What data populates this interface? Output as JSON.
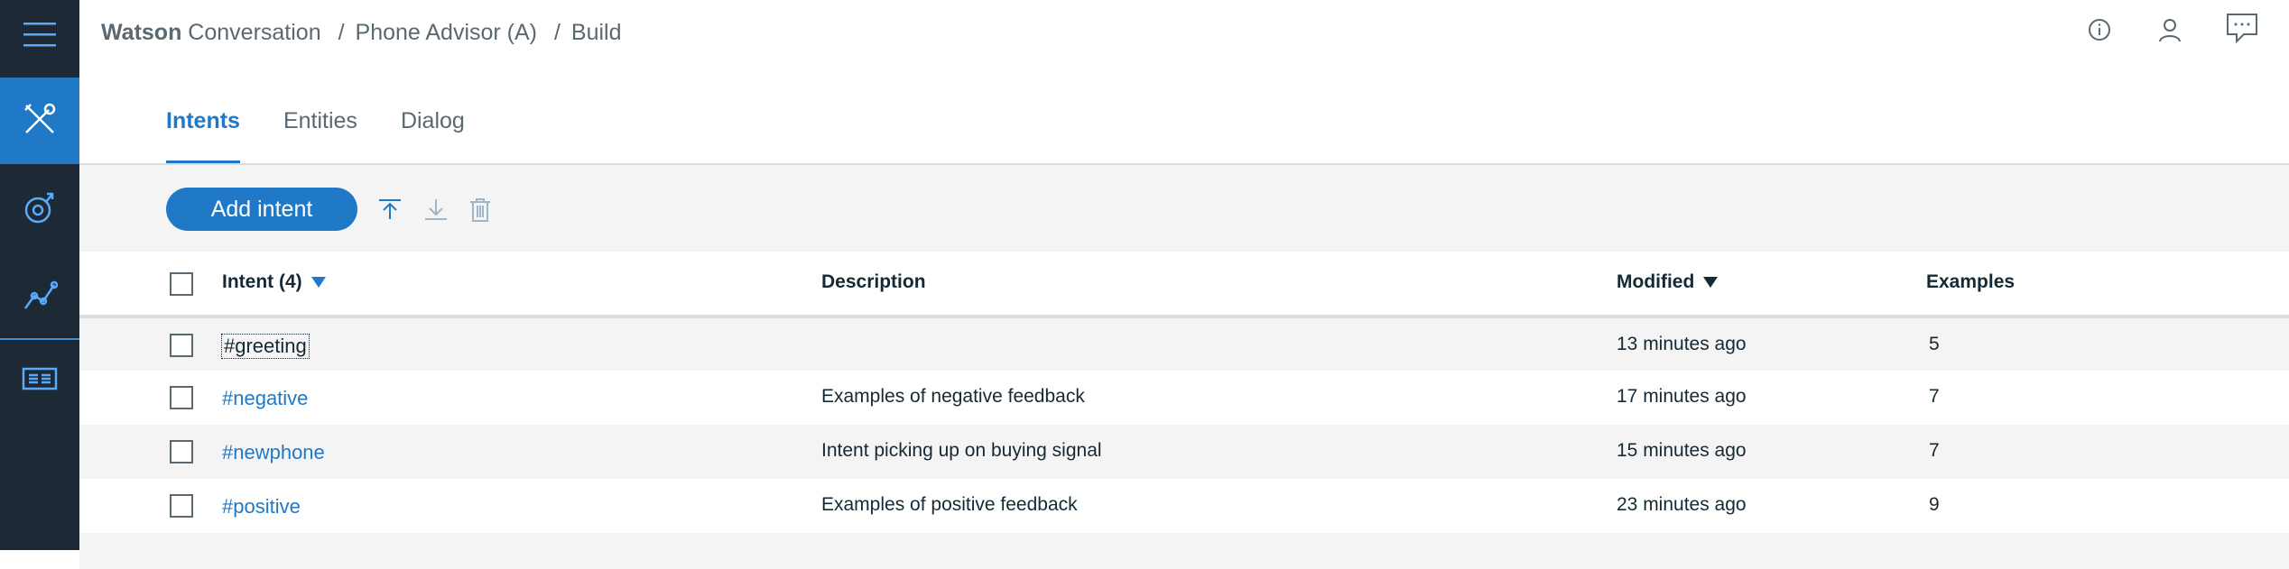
{
  "header": {
    "brand": "Watson",
    "app": "Conversation",
    "separator": "/",
    "workspace": "Phone Advisor (A)",
    "page": "Build"
  },
  "icons": {
    "header": [
      "info-icon",
      "user-icon",
      "chat-icon"
    ],
    "rail": [
      "menu-icon",
      "build-icon",
      "improve-icon",
      "analytics-icon",
      "deploy-icon"
    ],
    "toolbar": [
      "upload-icon",
      "download-icon",
      "trash-icon"
    ]
  },
  "colors": {
    "accent": "#2079c7",
    "rail_background": "#1d2a36",
    "toolbar_background": "#f4f4f4"
  },
  "tabs": [
    {
      "label": "Intents",
      "active": true
    },
    {
      "label": "Entities",
      "active": false
    },
    {
      "label": "Dialog",
      "active": false
    }
  ],
  "toolbar": {
    "add_label": "Add intent"
  },
  "table": {
    "columns": {
      "intent": "Intent (4)",
      "description": "Description",
      "modified": "Modified",
      "examples": "Examples"
    },
    "rows": [
      {
        "name": "#greeting",
        "description": "",
        "modified": "13 minutes ago",
        "examples": "5"
      },
      {
        "name": "#negative",
        "description": "Examples of negative feedback",
        "modified": "17 minutes ago",
        "examples": "7"
      },
      {
        "name": "#newphone",
        "description": "Intent picking up on buying signal",
        "modified": "15 minutes ago",
        "examples": "7"
      },
      {
        "name": "#positive",
        "description": "Examples of positive feedback",
        "modified": "23 minutes ago",
        "examples": "9"
      }
    ]
  }
}
